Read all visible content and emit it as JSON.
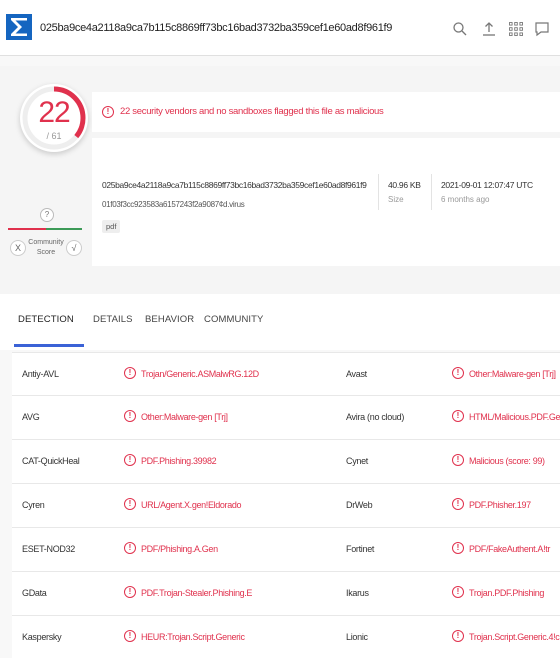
{
  "header": {
    "search_value": "025ba9ce4a2118a9ca7b115c8869ff73bc16bad3732ba359cef1e60ad8f961f9",
    "icons": [
      "search-icon",
      "upload-icon",
      "apps-grid-icon",
      "chat-icon"
    ]
  },
  "score": {
    "detections": "22",
    "total": "/ 61",
    "ring_fraction": 0.36
  },
  "community": {
    "score": "?",
    "label_line1": "Community",
    "label_line2": "Score",
    "downvote": "X",
    "upvote": "√"
  },
  "alert": {
    "icon": "!",
    "text": "22 security vendors and no sandboxes flagged this file as malicious"
  },
  "file": {
    "hash": "025ba9ce4a2118a9ca7b115c8869ff73bc16bad3732ba359cef1e60ad8f961f9",
    "name": "01f03f3cc923583a6157243f2a9087¢d.virus",
    "tag": "pdf",
    "size": "40.96 KB",
    "size_label": "Size",
    "date": "2021-09-01 12:07:47 UTC",
    "date_relative": "6 months ago"
  },
  "tabs": [
    "DETECTION",
    "DETAILS",
    "BEHAVIOR",
    "COMMUNITY"
  ],
  "detections": [
    {
      "left_vendor": "Antiy-AVL",
      "left_result": "Trojan/Generic.ASMalwRG.12D",
      "right_vendor": "Avast",
      "right_result": "Other:Malware-gen [Trj]"
    },
    {
      "left_vendor": "AVG",
      "left_result": "Other:Malware-gen [Trj]",
      "right_vendor": "Avira (no cloud)",
      "right_result": "HTML/Malicious.PDF.Gen"
    },
    {
      "left_vendor": "CAT-QuickHeal",
      "left_result": "PDF.Phishing.39982",
      "right_vendor": "Cynet",
      "right_result": "Malicious (score: 99)"
    },
    {
      "left_vendor": "Cyren",
      "left_result": "URL/Agent.X.gen!Eldorado",
      "right_vendor": "DrWeb",
      "right_result": "PDF.Phisher.197"
    },
    {
      "left_vendor": "ESET-NOD32",
      "left_result": "PDF/Phishing.A.Gen",
      "right_vendor": "Fortinet",
      "right_result": "PDF/FakeAuthent.A!tr"
    },
    {
      "left_vendor": "GData",
      "left_result": "PDF.Trojan-Stealer.Phishing.E",
      "right_vendor": "Ikarus",
      "right_result": "Trojan.PDF.Phishing"
    },
    {
      "left_vendor": "Kaspersky",
      "left_result": "HEUR:Trojan.Script.Generic",
      "right_vendor": "Lionic",
      "right_result": "Trojan.Script.Generic.4!c"
    }
  ],
  "colors": {
    "malicious": "#e0314d",
    "brand": "#1565c0",
    "active_tab": "#3b62d6",
    "harmless": "#3c9a57"
  }
}
